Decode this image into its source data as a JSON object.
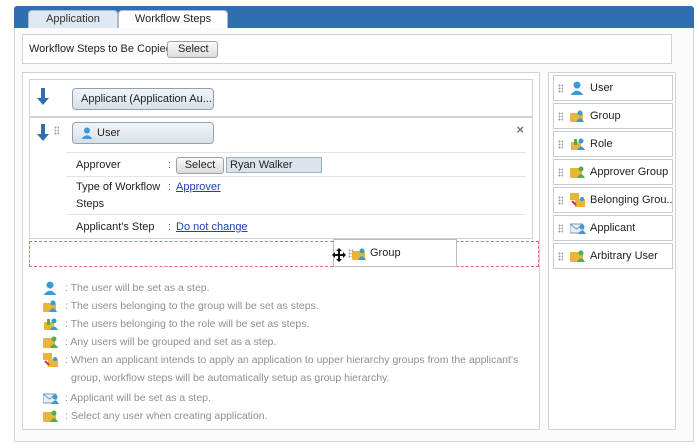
{
  "tabs": {
    "application": "Application",
    "workflow_steps": "Workflow Steps"
  },
  "copy_bar": {
    "label": "Workflow Steps to Be Copied :",
    "select_label": "Select"
  },
  "steps": {
    "step1_label": "Applicant (Application Au...",
    "step2_label": "User",
    "approver_label": "Approver",
    "approver_select": "Select",
    "approver_value": "Ryan Walker",
    "type_label": "Type of Workflow",
    "type_label2": "Steps",
    "type_value": "Approver",
    "applicant_step_label": "Applicant's Step",
    "applicant_step_value": "Do not change",
    "colon": ":"
  },
  "drag_ghost": {
    "label": "Group"
  },
  "legend": {
    "user": ": The user will be set as a step.",
    "group": ": The users belonging to the group will be set as steps.",
    "role": ": The users belonging to the role will be set as steps.",
    "approver_group": ": Any users will be grouped and set as a step.",
    "belonging_group_1": ": When an applicant intends to apply an application to upper hierarchy groups from the applicant's",
    "belonging_group_2": "group, workflow steps will be automatically setup as group hierarchy.",
    "applicant": ": Applicant will be set as a step.",
    "arbitrary_user": ": Select any user when creating application."
  },
  "palette": {
    "user": "User",
    "group": "Group",
    "role": "Role",
    "approver_group": "Approver Group",
    "belonging_group": "Belonging Grou...",
    "applicant": "Applicant",
    "arbitrary_user": "Arbitrary User"
  },
  "icons": {
    "user": "user-icon",
    "group": "group-icon",
    "role": "role-icon",
    "approver_group": "approver-group-icon",
    "belonging_group": "belonging-group-icon",
    "applicant": "applicant-icon",
    "arbitrary_user": "arbitrary-user-icon",
    "arrow": "down-arrow-icon",
    "drag": "move-cursor-icon",
    "close": "close-icon"
  },
  "colors": {
    "header_blue": "#2f6fb0",
    "link": "#1f3fb3",
    "drop_outline": "#e07070"
  }
}
